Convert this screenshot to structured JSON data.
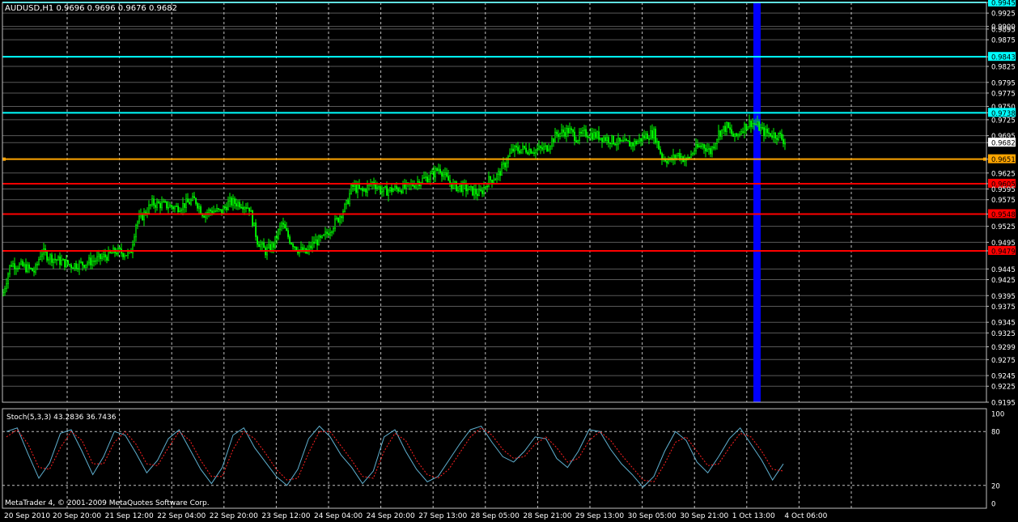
{
  "header": {
    "symbol_info": "AUDUSD,H1  0.9696 0.9696 0.9676 0.9682"
  },
  "footer": {
    "copyright": "MetaTrader 4, © 2001-2009 MetaQuotes Software Corp."
  },
  "colors": {
    "background": "#000000",
    "grid": "#ffffff",
    "candle": "#00ff00",
    "cyan_level": "#00ffff",
    "orange_level": "#ffa500",
    "red_level": "#ff0000",
    "blue_band": "#0000ff",
    "stoch_main": "#5fb0d0",
    "stoch_signal": "#ff2020"
  },
  "chart_data": [
    {
      "type": "candlestick",
      "title": "AUDUSD,H1  0.9696 0.9696 0.9676 0.9682",
      "ylim": [
        0.9195,
        0.9945
      ],
      "y_tick_labels": [
        "0.9945",
        "0.9925",
        "0.9900",
        "0.9895",
        "0.9875",
        "0.9843",
        "0.9825",
        "0.9795",
        "0.9775",
        "0.9750",
        "0.9738",
        "0.9725",
        "0.9695",
        "0.9682",
        "0.9651",
        "0.9625",
        "0.9605",
        "0.9595",
        "0.9575",
        "0.9548",
        "0.9525",
        "0.9495",
        "0.9479",
        "0.9445",
        "0.9425",
        "0.9395",
        "0.9375",
        "0.9345",
        "0.9325",
        "0.9299",
        "0.9275",
        "0.9245",
        "0.9225",
        "0.9195"
      ],
      "x_tick_labels": [
        "20 Sep 2010",
        "20 Sep 20:00",
        "21 Sep 12:00",
        "22 Sep 04:00",
        "22 Sep 20:00",
        "23 Sep 12:00",
        "24 Sep 04:00",
        "24 Sep 20:00",
        "27 Sep 13:00",
        "28 Sep 05:00",
        "28 Sep 21:00",
        "29 Sep 13:00",
        "30 Sep 05:00",
        "30 Sep 21:00",
        "1 Oct 13:00",
        "4 Oct 06:00"
      ],
      "current_price": 0.9682,
      "horizontal_levels": [
        {
          "price": 0.9945,
          "label": "0.9945",
          "color": "cyan"
        },
        {
          "price": 0.9843,
          "label": "0.9843",
          "color": "cyan"
        },
        {
          "price": 0.9738,
          "label": "0.9738",
          "color": "cyan"
        },
        {
          "price": 0.9651,
          "label": "0.9651",
          "color": "orange"
        },
        {
          "price": 0.9605,
          "label": "0.9605",
          "color": "red"
        },
        {
          "price": 0.9548,
          "label": "0.9548",
          "color": "red"
        },
        {
          "price": 0.9479,
          "label": "0.9479",
          "color": "red"
        }
      ],
      "close_path": [
        [
          0,
          0.9395
        ],
        [
          10,
          0.9455
        ],
        [
          25,
          0.945
        ],
        [
          40,
          0.944
        ],
        [
          48,
          0.9478
        ],
        [
          55,
          0.947
        ],
        [
          70,
          0.946
        ],
        [
          85,
          0.9452
        ],
        [
          100,
          0.9455
        ],
        [
          115,
          0.9462
        ],
        [
          130,
          0.947
        ],
        [
          140,
          0.9478
        ],
        [
          150,
          0.9475
        ],
        [
          158,
          0.9472
        ],
        [
          165,
          0.953
        ],
        [
          175,
          0.9548
        ],
        [
          185,
          0.9568
        ],
        [
          200,
          0.9565
        ],
        [
          215,
          0.956
        ],
        [
          228,
          0.9568
        ],
        [
          238,
          0.9575
        ],
        [
          248,
          0.9548
        ],
        [
          258,
          0.9555
        ],
        [
          270,
          0.9552
        ],
        [
          280,
          0.957
        ],
        [
          295,
          0.9568
        ],
        [
          305,
          0.956
        ],
        [
          315,
          0.9498
        ],
        [
          325,
          0.9478
        ],
        [
          335,
          0.949
        ],
        [
          345,
          0.953
        ],
        [
          355,
          0.95
        ],
        [
          365,
          0.9482
        ],
        [
          375,
          0.9475
        ],
        [
          385,
          0.9495
        ],
        [
          395,
          0.95
        ],
        [
          405,
          0.952
        ],
        [
          415,
          0.954
        ],
        [
          425,
          0.9565
        ],
        [
          432,
          0.96
        ],
        [
          445,
          0.959
        ],
        [
          458,
          0.9608
        ],
        [
          470,
          0.959
        ],
        [
          485,
          0.9595
        ],
        [
          500,
          0.9598
        ],
        [
          515,
          0.961
        ],
        [
          530,
          0.962
        ],
        [
          540,
          0.9635
        ],
        [
          548,
          0.9615
        ],
        [
          558,
          0.96
        ],
        [
          570,
          0.9598
        ],
        [
          582,
          0.959
        ],
        [
          590,
          0.9585
        ],
        [
          600,
          0.961
        ],
        [
          612,
          0.962
        ],
        [
          620,
          0.964
        ],
        [
          630,
          0.9668
        ],
        [
          645,
          0.967
        ],
        [
          660,
          0.9668
        ],
        [
          672,
          0.9672
        ],
        [
          685,
          0.9698
        ],
        [
          700,
          0.9705
        ],
        [
          710,
          0.969
        ],
        [
          720,
          0.97
        ],
        [
          735,
          0.9695
        ],
        [
          750,
          0.9688
        ],
        [
          765,
          0.968
        ],
        [
          780,
          0.968
        ],
        [
          795,
          0.9695
        ],
        [
          805,
          0.97
        ],
        [
          815,
          0.9655
        ],
        [
          825,
          0.9648
        ],
        [
          835,
          0.966
        ],
        [
          845,
          0.9648
        ],
        [
          855,
          0.9668
        ],
        [
          865,
          0.9678
        ],
        [
          875,
          0.9665
        ],
        [
          885,
          0.97
        ],
        [
          895,
          0.9712
        ],
        [
          905,
          0.969
        ],
        [
          915,
          0.971
        ],
        [
          925,
          0.972
        ],
        [
          932,
          0.9715
        ],
        [
          940,
          0.9702
        ],
        [
          950,
          0.9698
        ],
        [
          960,
          0.9695
        ],
        [
          968,
          0.9682
        ]
      ]
    },
    {
      "type": "line",
      "title": "Stoch(5,3,3) 43.2836 36.7436",
      "ylim": [
        0,
        100
      ],
      "y_tick_labels": [
        "100",
        "80",
        "20",
        "0"
      ],
      "levels": [
        80,
        20
      ],
      "series": [
        {
          "values": [
            80,
            84,
            55,
            28,
            45,
            78,
            82,
            58,
            32,
            52,
            80,
            76,
            56,
            34,
            48,
            72,
            82,
            60,
            38,
            22,
            40,
            76,
            84,
            62,
            46,
            30,
            20,
            38,
            72,
            86,
            74,
            54,
            40,
            22,
            36,
            74,
            82,
            58,
            38,
            24,
            30,
            48,
            66,
            82,
            86,
            68,
            52,
            46,
            58,
            74,
            72,
            50,
            40,
            58,
            82,
            80,
            60,
            44,
            32,
            18,
            30,
            58,
            80,
            70,
            46,
            34,
            52,
            72,
            84,
            66,
            48,
            26,
            44
          ]
        },
        {
          "values": [
            74,
            82,
            66,
            40,
            38,
            62,
            80,
            70,
            44,
            44,
            68,
            80,
            66,
            44,
            42,
            62,
            80,
            70,
            48,
            30,
            30,
            60,
            80,
            72,
            56,
            38,
            26,
            28,
            56,
            80,
            80,
            64,
            48,
            30,
            28,
            58,
            78,
            70,
            48,
            32,
            28,
            38,
            56,
            74,
            84,
            76,
            60,
            50,
            52,
            66,
            74,
            62,
            46,
            50,
            70,
            80,
            70,
            54,
            40,
            26,
            24,
            44,
            68,
            74,
            58,
            42,
            44,
            62,
            78,
            74,
            58,
            38,
            36
          ]
        }
      ]
    }
  ]
}
